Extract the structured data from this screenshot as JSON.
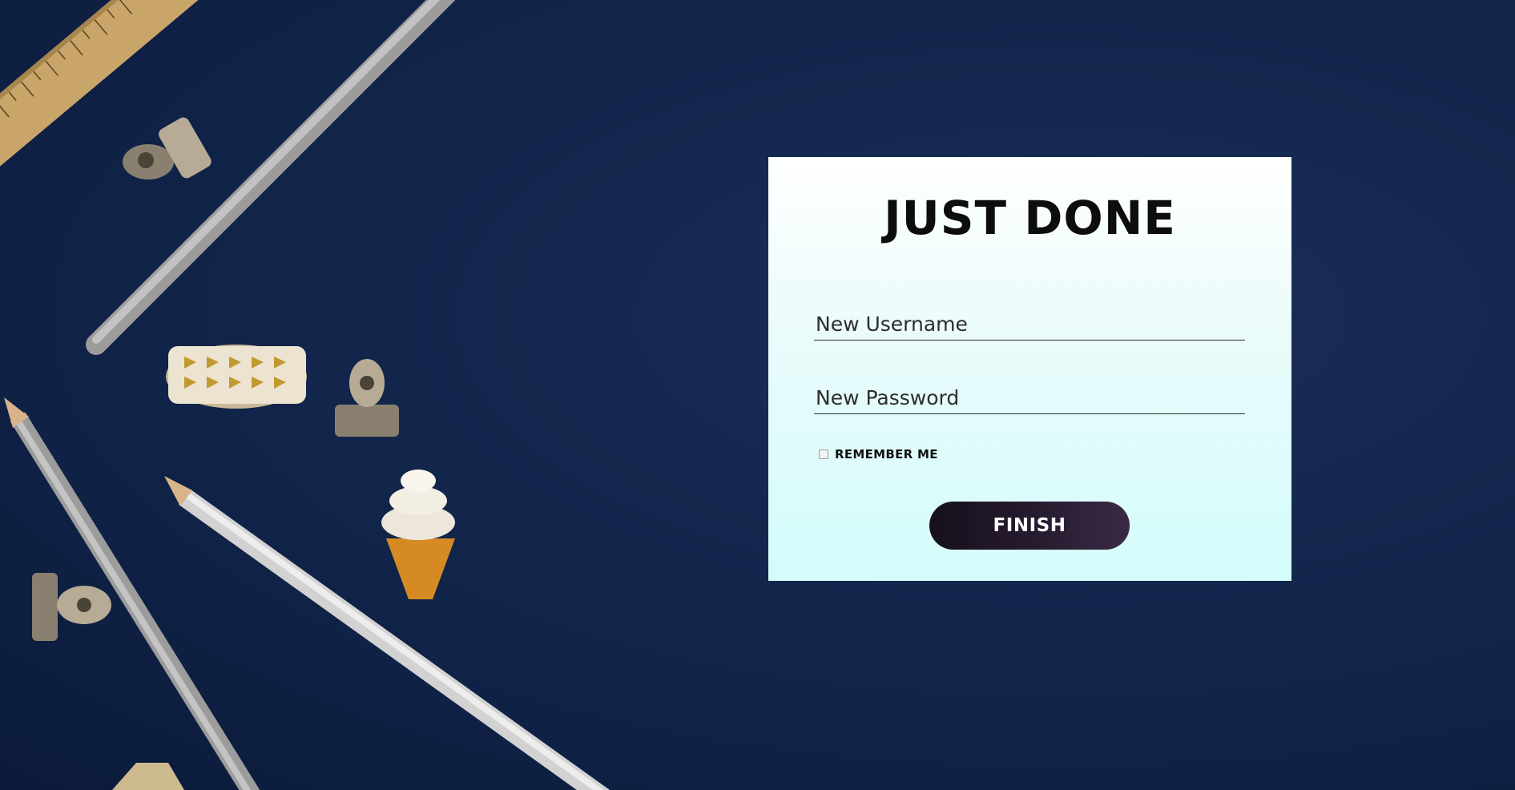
{
  "form": {
    "title": "JUST DONE",
    "username_placeholder": "New Username",
    "username_value": "",
    "password_placeholder": "New Password",
    "password_value": "",
    "remember_label": "REMEMBER ME",
    "remember_checked": false,
    "finish_label": "FINISH"
  },
  "colors": {
    "background": "#0f2145",
    "card_top": "#ffffff",
    "card_bottom": "#d3fcfb",
    "button": "#251a2e",
    "button_text": "#ffffff"
  }
}
